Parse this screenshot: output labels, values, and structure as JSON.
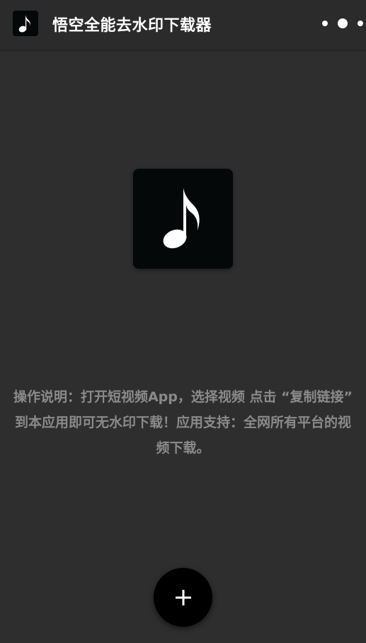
{
  "header": {
    "app_icon": "music-note-icon",
    "title": "悟空全能去水印下载器",
    "menu_icon": "more-dots-icon"
  },
  "main": {
    "logo_icon": "music-note-icon",
    "instructions": "操作说明：打开短视频App，选择视频 点击 “复制链接” 到本应用即可无水印下载！应用支持：全网所有平台的视频下载。"
  },
  "fab": {
    "icon": "plus-icon"
  },
  "colors": {
    "background": "#2e2e2e",
    "topbar": "#2b2b2b",
    "logo_bg": "#050808",
    "instruction_text": "#8a8a8a",
    "fab_bg": "#000000"
  }
}
